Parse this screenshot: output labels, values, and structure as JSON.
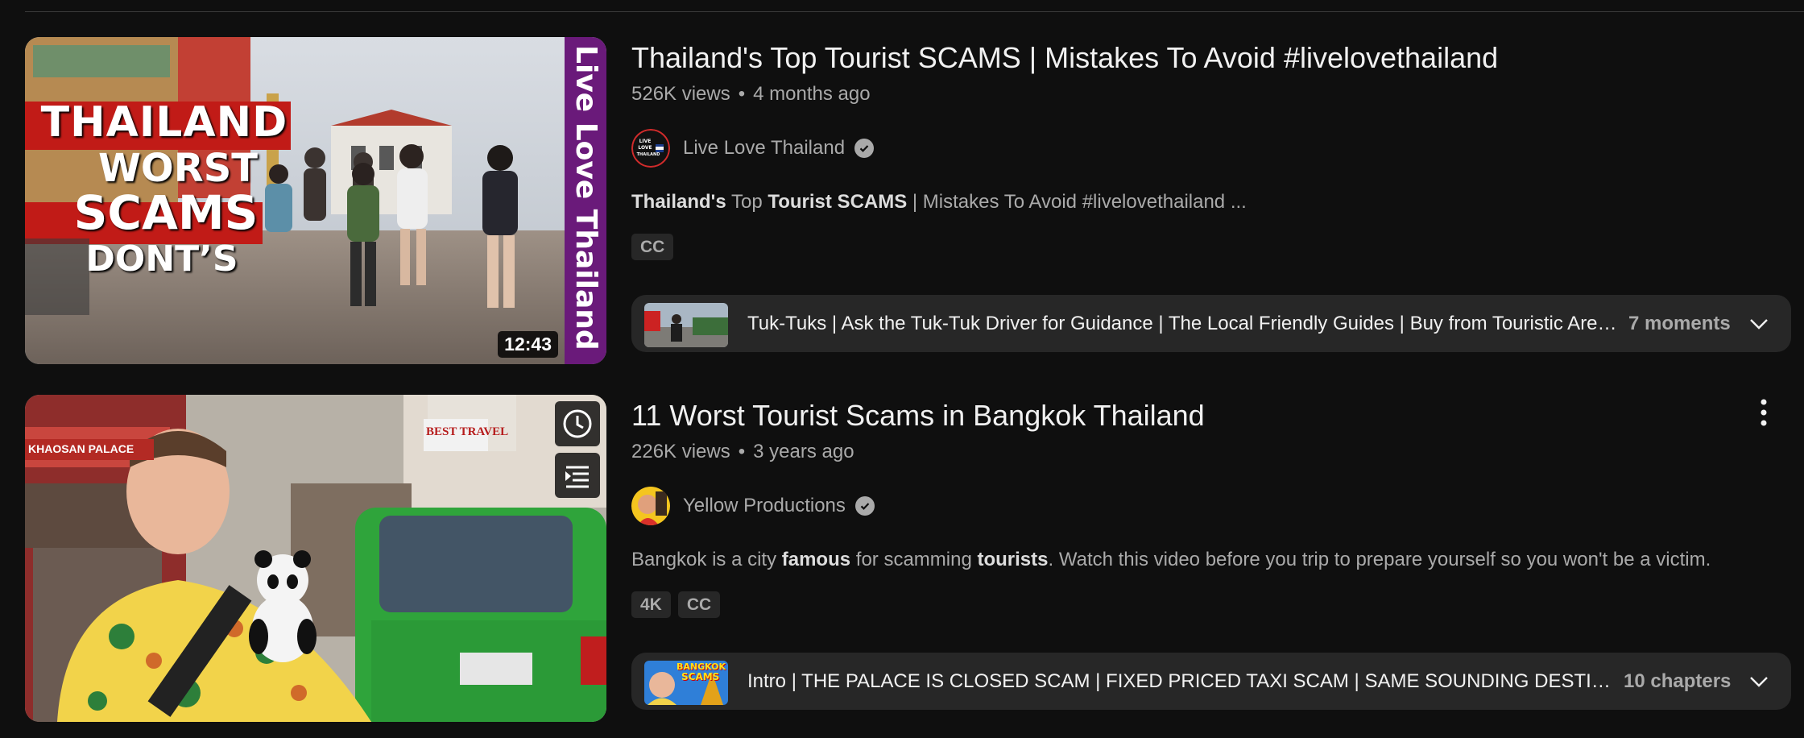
{
  "results": [
    {
      "title": "Thailand's Top Tourist SCAMS | Mistakes To Avoid #livelovethailand",
      "views": "526K views",
      "age": "4 months ago",
      "channel": "Live Love Thailand",
      "avatar_text": [
        "LIVE",
        "LOVE",
        "THAILAND"
      ],
      "description": [
        {
          "text": "Thailand's",
          "bold": true
        },
        {
          "text": " Top ",
          "bold": false
        },
        {
          "text": "Tourist SCAMS",
          "bold": true
        },
        {
          "text": " | Mistakes To Avoid #livelovethailand ...",
          "bold": false
        }
      ],
      "badges": [
        "CC"
      ],
      "duration": "12:43",
      "thumb_text": {
        "line1": "THAILAND",
        "line2": "WORST",
        "line3": "SCAMS",
        "line4": "DONT’S",
        "side": "Live Love Thailand"
      },
      "moments_text": "Tuk-Tuks | Ask the Tuk-Tuk Driver for Guidance | The Local Friendly Guides | Buy from Touristic Areas | Don't ...",
      "moments_count": "7 moments"
    },
    {
      "title": "11 Worst Tourist Scams in Bangkok Thailand",
      "views": "226K views",
      "age": "3 years ago",
      "channel": "Yellow Productions",
      "description": [
        {
          "text": "Bangkok is a city ",
          "bold": false
        },
        {
          "text": "famous",
          "bold": true
        },
        {
          "text": " for scamming ",
          "bold": false
        },
        {
          "text": "tourists",
          "bold": true
        },
        {
          "text": ". Watch this video before you trip to prepare yourself so you won't be a victim.",
          "bold": false
        }
      ],
      "badges": [
        "4K",
        "CC"
      ],
      "thumb_text": {
        "sign1": "BEST TRAVEL",
        "sign2": "KHAOSAN PALACE"
      },
      "chapter_thumb_text": [
        "BANGKOK",
        "SCAMS"
      ],
      "chapters_text": "Intro | THE PALACE IS CLOSED SCAM | FIXED PRICED TAXI SCAM | SAME SOUNDING DESTINATIONS SCAM | GEM SCAM",
      "chapters_count": "10 chapters"
    }
  ],
  "icons": {
    "verified": "check-circle-icon",
    "chevron": "chevron-down-icon",
    "watch_later": "clock-icon",
    "add_queue": "queue-icon",
    "more": "more-vert-icon"
  },
  "colors": {
    "background": "#0f0f0f",
    "chip_bg": "#272727",
    "text_primary": "#f1f1f1",
    "text_secondary": "#aaaaaa"
  }
}
